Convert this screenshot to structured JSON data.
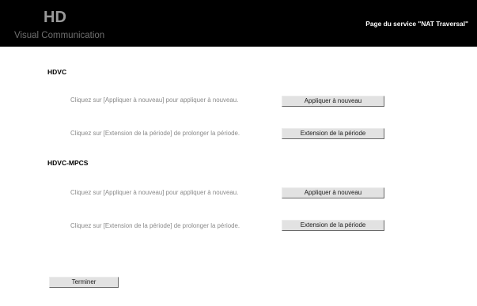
{
  "header": {
    "logo_mark": "HD",
    "logo_text": "Visual Communication",
    "title": "Page du service \"NAT Traversal\""
  },
  "sections": [
    {
      "title": "HDVC",
      "rows": [
        {
          "text": "Cliquez sur [Appliquer à nouveau] pour appliquer à nouveau.",
          "button": "Appliquer à nouveau"
        },
        {
          "text": "Cliquez sur [Extension de la période] de prolonger la période.",
          "button": "Extension de la période"
        }
      ]
    },
    {
      "title": "HDVC-MPCS",
      "rows": [
        {
          "text": "Cliquez sur [Appliquer à nouveau] pour appliquer à nouveau.",
          "button": "Appliquer à nouveau"
        },
        {
          "text": "Cliquez sur [Extension de la période] de prolonger la période.",
          "button": "Extension de la période"
        }
      ]
    }
  ],
  "footer": {
    "finish_label": "Terminer"
  }
}
